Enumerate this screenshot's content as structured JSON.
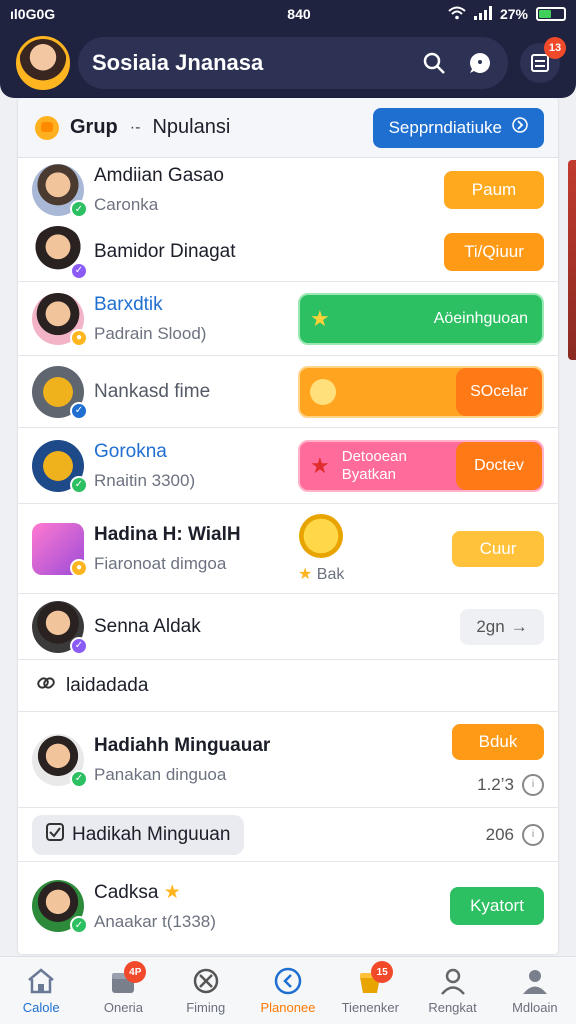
{
  "status": {
    "carrier": "ıl0G0G",
    "time": "840",
    "battery": "27%"
  },
  "header": {
    "title": "Sosiaia Jnanasa",
    "badge": "13"
  },
  "group": {
    "label": "Grup",
    "sep": "·-",
    "sub": "Npulansi",
    "cta": "Sepprndiatiuke"
  },
  "rows": [
    {
      "name": "Amdiian Gasao",
      "sub": "Caronka",
      "button": "Paum",
      "button_color": "#ffa91f"
    },
    {
      "name": "Bamidor Dinagat",
      "sub": "",
      "button": "Ti/Qiuur",
      "button_color": "#ff9a17"
    },
    {
      "name": "Barxdtik",
      "sub": "Padrain Slood)",
      "button": "Aöeinhguoan",
      "button_color": "#2cc062"
    },
    {
      "name": "Nankasd fime",
      "sub": "",
      "button": "SOcelar",
      "button_color": "#ff9a17"
    },
    {
      "name": "Gorokna",
      "sub": "Rnaitin 3300)",
      "button_l1": "Detooean",
      "button_l2": "Byatkan",
      "button_r": "Doctev",
      "button_color": "#ff5b8c"
    },
    {
      "name": "Hadina H: WialH",
      "sub": "Fiaronoat dimgoa",
      "mid_label": "Bak",
      "button": "Cuur",
      "button_color": "#ffc23a"
    },
    {
      "name": "Senna Aldak",
      "sub": "",
      "button": "2gn",
      "button_color": "#eef0f4"
    }
  ],
  "section1": {
    "label": "laidadada"
  },
  "row_week": {
    "name": "Hadiahh Minguauar",
    "sub": "Panakan dinguoa",
    "button": "Bduk",
    "count": "1.2ʼ3",
    "button_color": "#ff9a17"
  },
  "section2": {
    "chip": "Hadikah Minguuan",
    "count": "206"
  },
  "row_last": {
    "name": "Cadksa",
    "sub": "Anaakar t(1338)",
    "button": "Kyatort",
    "button_color": "#2cc062"
  },
  "tabs": [
    {
      "label": "Calole",
      "icon": "home-icon"
    },
    {
      "label": "Oneria",
      "icon": "box-icon",
      "badge": "4P"
    },
    {
      "label": "Fiming",
      "icon": "tools-icon"
    },
    {
      "label": "Planonee",
      "icon": "compass-icon",
      "active": true
    },
    {
      "label": "Tienenker",
      "icon": "bucket-icon",
      "badge": "15"
    },
    {
      "label": "Rengkat",
      "icon": "user-icon"
    },
    {
      "label": "Mdloain",
      "icon": "profile-icon"
    }
  ]
}
